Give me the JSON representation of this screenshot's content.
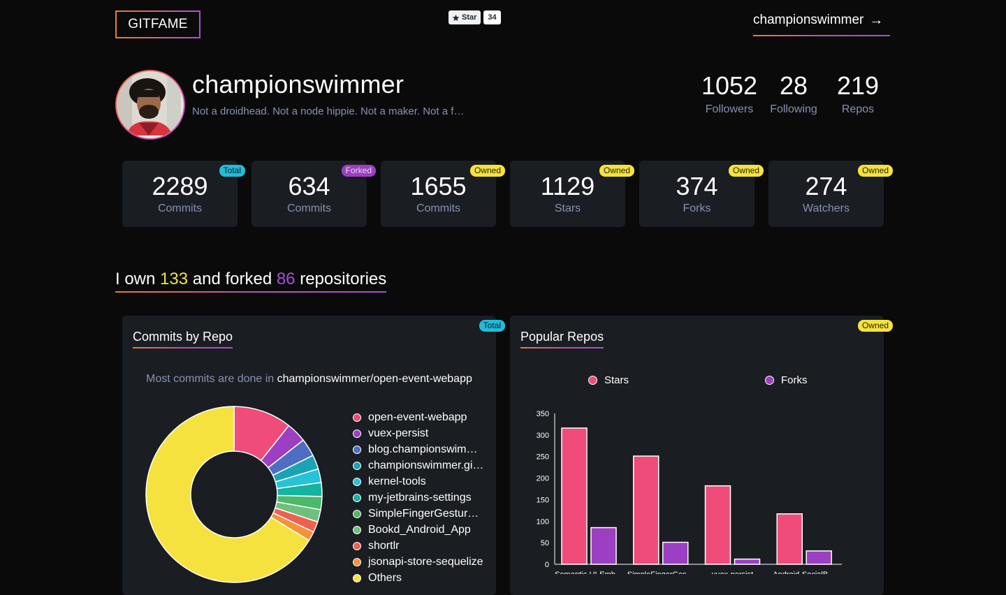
{
  "header": {
    "logo": "GITFAME",
    "star_label": "Star",
    "star_count": "34",
    "user_link": "championswimmer",
    "user_link_arrow": "→"
  },
  "profile": {
    "name": "championswimmer",
    "bio": "Not a droidhead. Not a node hippie. Not a maker. Not a f…",
    "counts": [
      {
        "value": "1052",
        "label": "Followers"
      },
      {
        "value": "28",
        "label": "Following"
      },
      {
        "value": "219",
        "label": "Repos"
      }
    ]
  },
  "stats": [
    {
      "value": "2289",
      "label": "Commits",
      "badge": "Total",
      "badge_type": "total"
    },
    {
      "value": "634",
      "label": "Commits",
      "badge": "Forked",
      "badge_type": "forked"
    },
    {
      "value": "1655",
      "label": "Commits",
      "badge": "Owned",
      "badge_type": "owned"
    },
    {
      "value": "1129",
      "label": "Stars",
      "badge": "Owned",
      "badge_type": "owned"
    },
    {
      "value": "374",
      "label": "Forks",
      "badge": "Owned",
      "badge_type": "owned"
    },
    {
      "value": "274",
      "label": "Watchers",
      "badge": "Owned",
      "badge_type": "owned"
    }
  ],
  "headline": {
    "pre": "I own ",
    "owned": "133",
    "mid": " and forked ",
    "forked": "86",
    "post": " repositories"
  },
  "commits_panel": {
    "title": "Commits by Repo",
    "badge": "Total",
    "caption_pre": "Most commits are done in ",
    "caption_repo": "championswimmer/open-event-webapp"
  },
  "popular_panel": {
    "title": "Popular Repos",
    "badge": "Owned"
  },
  "colors": {
    "pink": "#ef4c7a",
    "purple": "#9c3fc2",
    "yellow": "#f5e23f",
    "cyan": "#22bcd8",
    "muted": "#8792b2"
  },
  "chart_data": [
    {
      "type": "pie",
      "title": "Commits by Repo",
      "labels": [
        "open-event-webapp",
        "vuex-persist",
        "blog.championswim…",
        "championswimmer.gi…",
        "kernel-tools",
        "my-jetbrains-settings",
        "SimpleFingerGestur…",
        "Bookd_Android_App",
        "shortlr",
        "jsonapi-store-sequelize",
        "Others"
      ],
      "values": [
        245,
        85,
        75,
        60,
        58,
        58,
        55,
        52,
        45,
        40,
        1516
      ],
      "colors": [
        "#ef4c7a",
        "#9c3fc2",
        "#4e6ec4",
        "#1aa3b5",
        "#26c2d9",
        "#15b3a0",
        "#4cb86a",
        "#6ec07f",
        "#f0604f",
        "#f59236",
        "#f5e23f"
      ],
      "donut": true
    },
    {
      "type": "bar",
      "title": "Popular Repos",
      "categories": [
        "Semantic-UI-Emb…",
        "SimpleFingerGes…",
        "vuex-persist",
        "Android-SocialB…"
      ],
      "series": [
        {
          "name": "Stars",
          "values": [
            316,
            251,
            182,
            117
          ],
          "color": "#ef4c7a"
        },
        {
          "name": "Forks",
          "values": [
            85,
            51,
            12,
            31
          ],
          "color": "#9c3fc2"
        }
      ],
      "ylim": [
        0,
        350
      ],
      "yticks": [
        0,
        50,
        100,
        150,
        200,
        250,
        300,
        350
      ],
      "legend": "top"
    }
  ]
}
